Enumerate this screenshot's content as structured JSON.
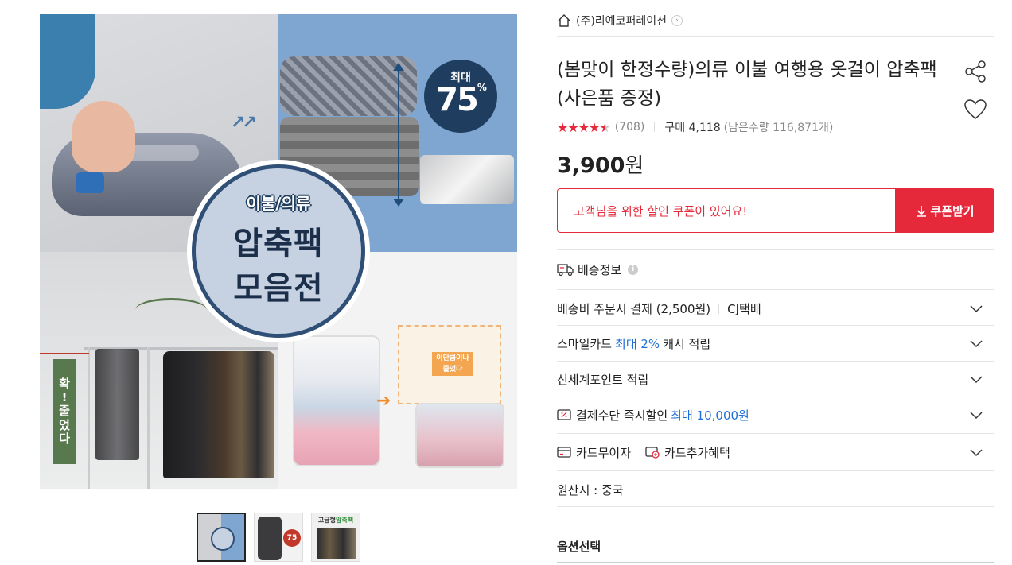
{
  "gallery": {
    "main_image": {
      "badge_top": "최대",
      "badge_number": "75",
      "badge_percent": "%",
      "circle_subtitle": "이불/의류",
      "circle_line1": "압축팩",
      "circle_line2": "모음전",
      "vertical_label": [
        "확",
        "!",
        "줄",
        "었",
        "다"
      ],
      "tag_text": "이만큼이나 줄었다"
    },
    "thumbnails": [
      {
        "active": true
      },
      {
        "badge": "75"
      },
      {
        "title_prefix": "고급형",
        "title_highlight": "압축팩"
      }
    ]
  },
  "seller": {
    "name": "(주)리예코퍼레이션",
    "icon": "home-icon"
  },
  "product": {
    "title": "(봄맞이 한정수량)의류 이불 여행용 옷걸이 압축팩(사은품 증정)",
    "rating": 4.5,
    "review_count": "(708)",
    "purchase_label": "구매 4,118",
    "remaining_label": "(남은수량 116,871개)",
    "price_number": "3,900",
    "price_unit": "원"
  },
  "coupon": {
    "message": "고객님을 위한 할인 쿠폰이 있어요!",
    "button_label": "쿠폰받기",
    "button_icon": "download-arrow-icon"
  },
  "shipping": {
    "header": "배송정보",
    "rows": {
      "fee": {
        "label": "배송비 주문시 결제 (2,500원)",
        "carrier": "CJ택배"
      },
      "smile_card": {
        "prefix": "스마일카드",
        "highlight": "최대 2%",
        "suffix": "캐시 적립"
      },
      "shinsegae": {
        "label": "신세계포인트 적립"
      },
      "payment_discount": {
        "prefix": "결제수단 즉시할인",
        "highlight": "최대 10,000원"
      },
      "cards": {
        "interest_free": "카드무이자",
        "card_benefit": "카드추가혜택"
      },
      "origin": {
        "label": "원산지 : 중국"
      }
    }
  },
  "options": {
    "title": "옵션선택"
  },
  "colors": {
    "accent_red": "#e5283a",
    "link_blue": "#1f6fd6",
    "badge_navy": "#1f3d5e"
  }
}
